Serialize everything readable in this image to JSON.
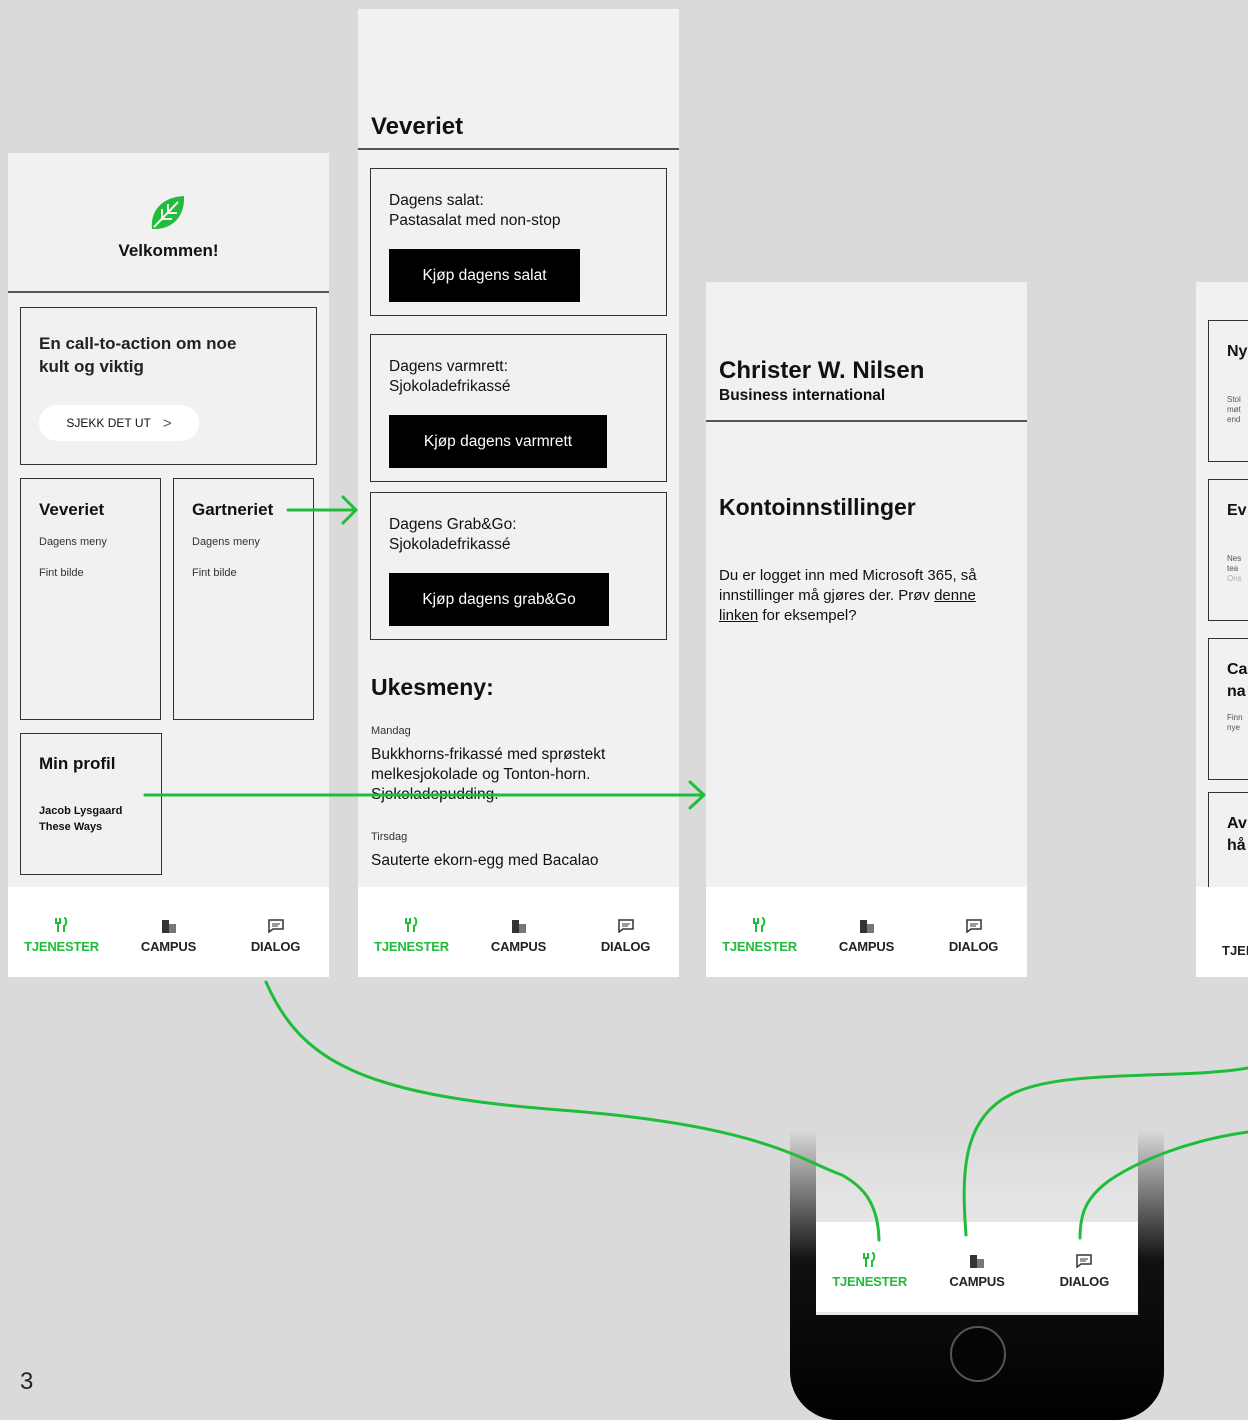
{
  "page_number": "3",
  "colors": {
    "accent": "#1fbd3a",
    "background": "#dadada",
    "screen": "#f1f1f1"
  },
  "tabs": [
    {
      "label": "TJENESTER",
      "icon": "cutlery-icon",
      "active": true
    },
    {
      "label": "CAMPUS",
      "icon": "building-icon",
      "active": false
    },
    {
      "label": "DIALOG",
      "icon": "chat-icon",
      "active": false
    }
  ],
  "home": {
    "logo": "leaf-icon",
    "welcome": "Velkommen!",
    "cta_text": "En call-to-action om noe kult og viktig",
    "cta_button": "SJEKK DET UT",
    "tiles": [
      {
        "title": "Veveriet",
        "line1": "Dagens meny",
        "line2": "Fint bilde"
      },
      {
        "title": "Gartneriet",
        "line1": "Dagens meny",
        "line2": "Fint bilde"
      }
    ],
    "profile": {
      "title": "Min profil",
      "name": "Jacob Lysgaard",
      "company": "These Ways"
    }
  },
  "veveriet": {
    "title": "Veveriet",
    "items": [
      {
        "line1": "Dagens salat:",
        "line2": "Pastasalat med non-stop",
        "button": "Kjøp dagens salat"
      },
      {
        "line1": "Dagens varmrett:",
        "line2": "Sjokoladefrikassé",
        "button": "Kjøp dagens varmrett"
      },
      {
        "line1": "Dagens Grab&Go:",
        "line2": "Sjokoladefrikassé",
        "button": "Kjøp dagens grab&Go"
      }
    ],
    "week_title": "Ukesmeny:",
    "days": [
      {
        "day": "Mandag",
        "l1": "Bukkhorns-frikassé med sprøstekt",
        "l2": "melkesjokolade og Tonton-horn.",
        "l3": "Sjokoladepudding."
      },
      {
        "day": "Tirsdag",
        "l1": "Sauterte ekorn-egg med Bacalao"
      }
    ]
  },
  "profile_screen": {
    "name": "Christer W. Nilsen",
    "company": "Business international",
    "section": "Kontoinnstillinger",
    "text1": "Du er logget inn med Microsoft 365, så",
    "text2a": "innstillinger må gjøres der. Prøv ",
    "link1": "denne",
    "link2": "linken",
    "text3": " for eksempel?"
  },
  "dialog_screen": {
    "cards": [
      {
        "title": "Ny",
        "body": [
          "Stol",
          "møt",
          "end"
        ]
      },
      {
        "title": "Ev",
        "body": [
          "Nes",
          "tea",
          "Ons"
        ]
      },
      {
        "title": "Ca",
        "title2": "na",
        "body": [
          "Finn",
          "nye"
        ]
      },
      {
        "title": "Av",
        "title2": "hå"
      }
    ],
    "tab_partial": "TJEN"
  }
}
